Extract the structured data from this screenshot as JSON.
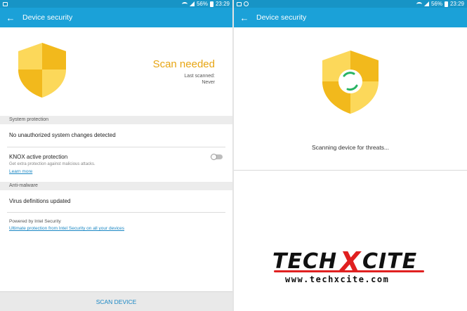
{
  "status_bar": {
    "battery": "56%",
    "time": "23:29"
  },
  "left": {
    "app_title": "Device security",
    "scan_status": "Scan needed",
    "last_scanned_label": "Last scanned:",
    "last_scanned_value": "Never",
    "sections": {
      "system_protection": "System protection",
      "anti_malware": "Anti-malware"
    },
    "system_changes": "No unauthorized system changes detected",
    "knox": {
      "title": "KNOX active protection",
      "description": "Get extra protection against malicious attacks.",
      "link": "Learn more",
      "enabled": false
    },
    "virus_definitions": "Virus definitions updated",
    "powered_by": "Powered by Intel Security",
    "intel_link": "Ultimate protection from Intel Security on all your devices",
    "scan_button": "SCAN DEVICE"
  },
  "right": {
    "app_title": "Device security",
    "scanning_text": "Scanning device for threats..."
  },
  "watermark": {
    "brand_left": "TECH",
    "brand_x": "X",
    "brand_right": "CITE",
    "url": "www.techxcite.com"
  },
  "colors": {
    "status_bar": "#1794c6",
    "app_bar": "#1ba1d8",
    "accent_orange": "#e7a513",
    "shield_light": "#fcd85a",
    "shield_dark": "#f2b91c",
    "link_blue": "#1a87c4",
    "spinner_green": "#28b463"
  }
}
